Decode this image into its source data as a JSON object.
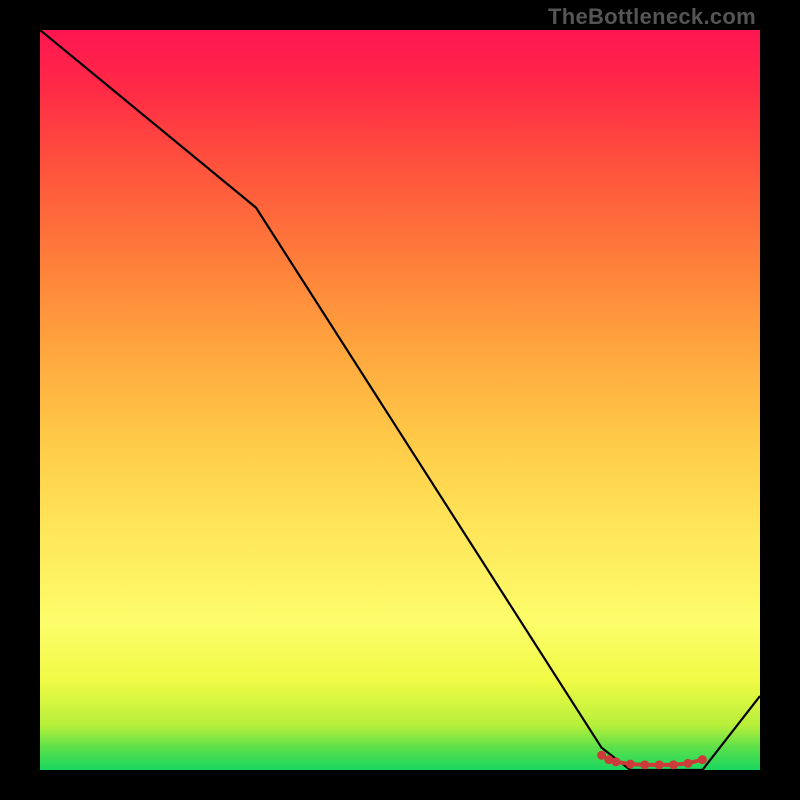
{
  "watermark": "TheBottleneck.com",
  "chart_data": {
    "type": "line",
    "title": "",
    "xlabel": "",
    "ylabel": "",
    "xlim": [
      0,
      100
    ],
    "ylim": [
      0,
      100
    ],
    "grid": false,
    "legend": false,
    "series": [
      {
        "name": "bottleneck-curve",
        "x": [
          0,
          30,
          78,
          82,
          85,
          88,
          92,
          100
        ],
        "values": [
          100,
          76,
          3,
          0,
          0,
          0,
          0,
          10
        ]
      }
    ],
    "markers": {
      "name": "optimal-range-markers",
      "color": "#cc3a3a",
      "points": [
        {
          "x": 78,
          "y": 2
        },
        {
          "x": 79,
          "y": 1.4
        },
        {
          "x": 80,
          "y": 1.1
        },
        {
          "x": 82,
          "y": 0.8
        },
        {
          "x": 84,
          "y": 0.7
        },
        {
          "x": 86,
          "y": 0.7
        },
        {
          "x": 88,
          "y": 0.7
        },
        {
          "x": 90,
          "y": 0.9
        },
        {
          "x": 92,
          "y": 1.4
        }
      ]
    },
    "background_gradient": {
      "bottom": "#18d860",
      "mid": "#fdfd6a",
      "top": "#ff1651"
    }
  }
}
